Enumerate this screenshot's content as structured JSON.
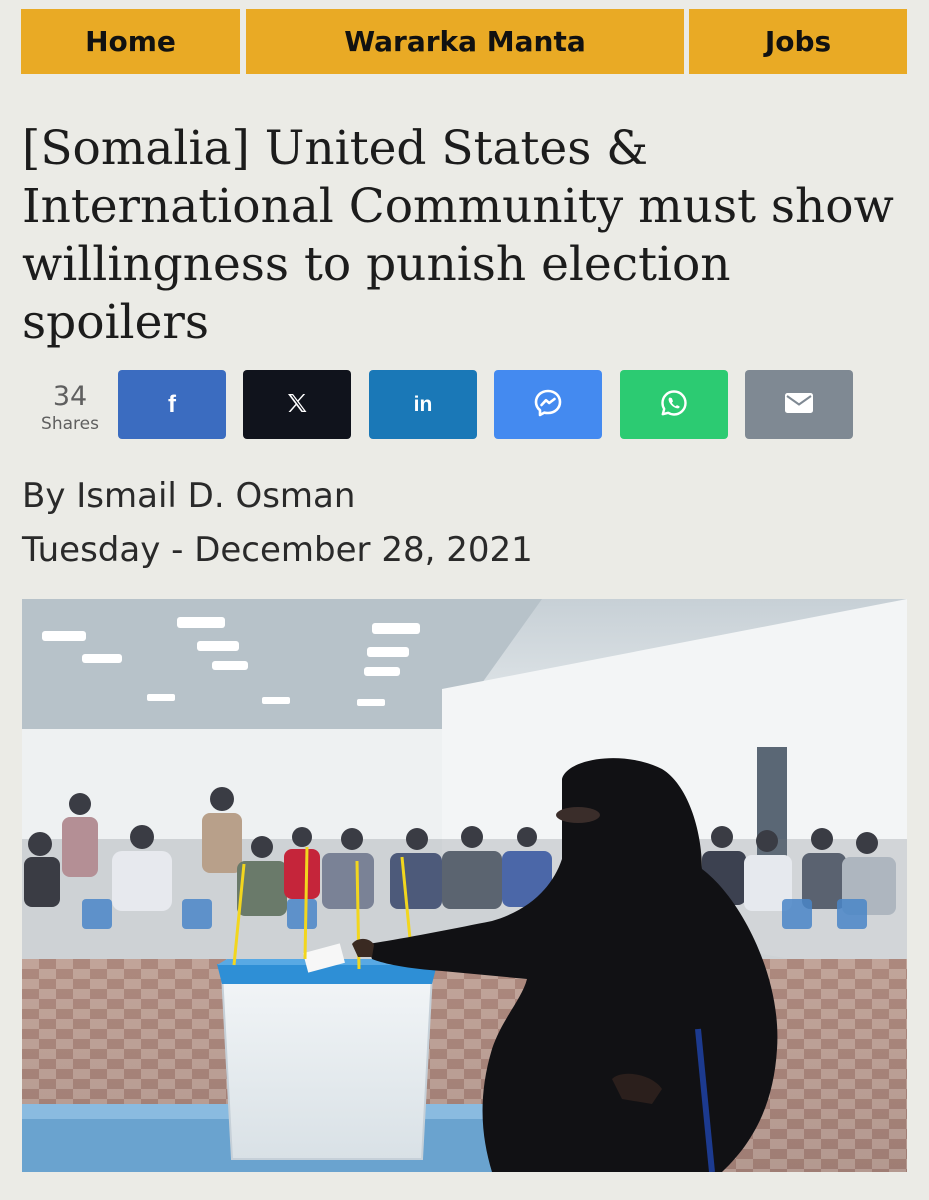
{
  "nav": {
    "home": "Home",
    "wararka": "Wararka Manta",
    "jobs": "Jobs"
  },
  "colors": {
    "nav_bg": "#e9aa25",
    "facebook": "#3b6cc0",
    "x": "#10131c",
    "linkedin": "#1a78b7",
    "messenger": "#448af0",
    "whatsapp": "#2ccb72",
    "email": "#7f8993"
  },
  "article": {
    "title": "[Somalia] United States & International Community must show willingness to punish election spoilers",
    "byline": "By Ismail D. Osman",
    "date": "Tuesday - December 28, 2021"
  },
  "share": {
    "count": "34",
    "label": "Shares",
    "buttons": [
      {
        "icon": "facebook-icon"
      },
      {
        "icon": "x-icon"
      },
      {
        "icon": "linkedin-icon"
      },
      {
        "icon": "messenger-icon"
      },
      {
        "icon": "whatsapp-icon"
      },
      {
        "icon": "email-icon"
      }
    ]
  }
}
